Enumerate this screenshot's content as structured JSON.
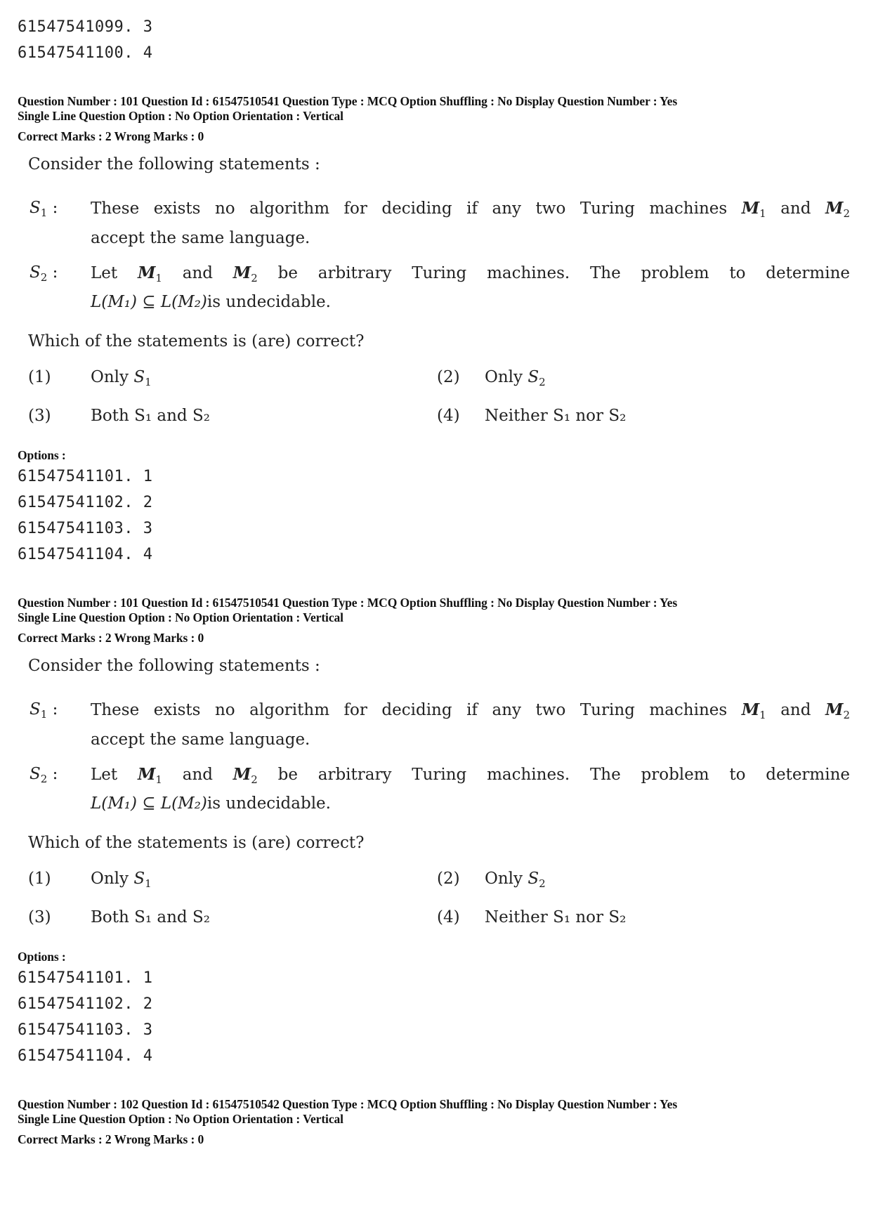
{
  "top_options": [
    {
      "id": "61547541099",
      "value": "3"
    },
    {
      "id": "61547541100",
      "value": "4"
    }
  ],
  "questions": [
    {
      "header_line1": "Question Number : 101  Question Id : 61547510541  Question Type : MCQ  Option Shuffling : No  Display Question Number : Yes",
      "header_line2": "Single Line Question Option : No  Option Orientation : Vertical",
      "marks": "Correct Marks : 2  Wrong Marks : 0",
      "intro": "Consider the following statements :",
      "statements": [
        {
          "label": "S",
          "sub": "1",
          "text_before": "These exists no algorithm for deciding if any two Turing machines",
          "m1": "M",
          "m1_sub": "1",
          "and": "and",
          "m2": "M",
          "m2_sub": "2",
          "line2": "accept the same language."
        },
        {
          "label": "S",
          "sub": "2",
          "text_before": "Let",
          "m1": "M",
          "m1_sub": "1",
          "and": "and",
          "m2": "M",
          "m2_sub": "2",
          "text_after": "be arbitrary Turing machines. The problem to determine",
          "line2_math": "L(M₁) ⊆ L(M₂)",
          "line2": "is undecidable."
        }
      ],
      "prompt": "Which of the statements is (are) correct?",
      "choices": [
        {
          "num": "(1)",
          "text": "Only S",
          "sub": "1"
        },
        {
          "num": "(2)",
          "text": "Only S",
          "sub": "2"
        },
        {
          "num": "(3)",
          "text": "Both S₁ and S₂"
        },
        {
          "num": "(4)",
          "text": "Neither S₁ nor S₂"
        }
      ],
      "options_label": "Options :",
      "options": [
        {
          "id": "61547541101",
          "value": "1"
        },
        {
          "id": "61547541102",
          "value": "2"
        },
        {
          "id": "61547541103",
          "value": "3"
        },
        {
          "id": "61547541104",
          "value": "4"
        }
      ]
    },
    {
      "header_line1": "Question Number : 101  Question Id : 61547510541  Question Type : MCQ  Option Shuffling : No  Display Question Number : Yes",
      "header_line2": "Single Line Question Option : No  Option Orientation : Vertical",
      "marks": "Correct Marks : 2  Wrong Marks : 0",
      "intro": "Consider the following statements :",
      "statements": [
        {
          "label": "S",
          "sub": "1",
          "text_before": "These exists no algorithm for deciding if any two Turing machines",
          "m1": "M",
          "m1_sub": "1",
          "and": "and",
          "m2": "M",
          "m2_sub": "2",
          "line2": "accept the same language."
        },
        {
          "label": "S",
          "sub": "2",
          "text_before": "Let",
          "m1": "M",
          "m1_sub": "1",
          "and": "and",
          "m2": "M",
          "m2_sub": "2",
          "text_after": "be arbitrary Turing machines. The problem to determine",
          "line2_math": "L(M₁) ⊆ L(M₂)",
          "line2": "is undecidable."
        }
      ],
      "prompt": "Which of the statements is (are) correct?",
      "choices": [
        {
          "num": "(1)",
          "text": "Only S",
          "sub": "1"
        },
        {
          "num": "(2)",
          "text": "Only S",
          "sub": "2"
        },
        {
          "num": "(3)",
          "text": "Both S₁ and S₂"
        },
        {
          "num": "(4)",
          "text": "Neither S₁ nor S₂"
        }
      ],
      "options_label": "Options :",
      "options": [
        {
          "id": "61547541101",
          "value": "1"
        },
        {
          "id": "61547541102",
          "value": "2"
        },
        {
          "id": "61547541103",
          "value": "3"
        },
        {
          "id": "61547541104",
          "value": "4"
        }
      ]
    },
    {
      "header_line1": "Question Number : 102  Question Id : 61547510542  Question Type : MCQ  Option Shuffling : No  Display Question Number : Yes",
      "header_line2": "Single Line Question Option : No  Option Orientation : Vertical",
      "marks": "Correct Marks : 2  Wrong Marks : 0"
    }
  ]
}
